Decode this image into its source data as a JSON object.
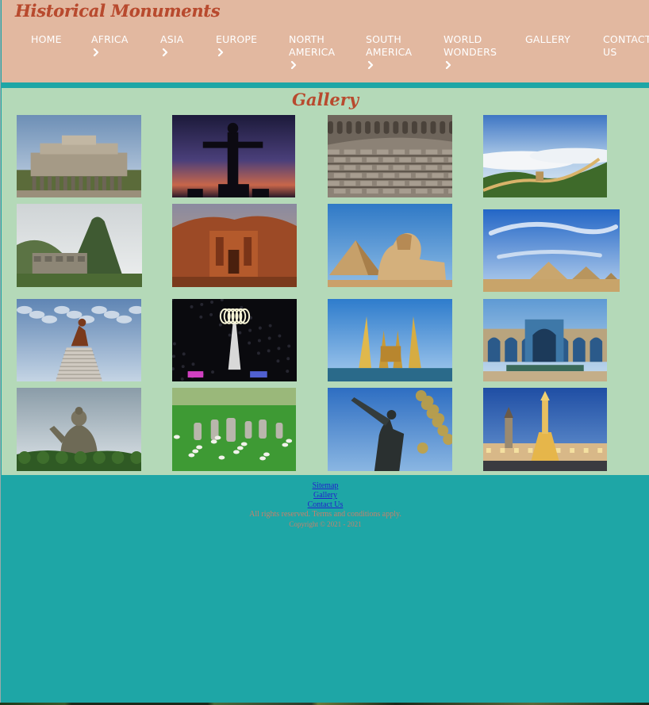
{
  "header": {
    "brand": "Historical Monuments",
    "nav": [
      {
        "label": "HOME",
        "lines": [
          "HOME"
        ],
        "has_chevron": false
      },
      {
        "label": "AFRICA",
        "lines": [
          "AFRICA"
        ],
        "has_chevron": true
      },
      {
        "label": "ASIA",
        "lines": [
          "ASIA"
        ],
        "has_chevron": true
      },
      {
        "label": "EUROPE",
        "lines": [
          "EUROPE"
        ],
        "has_chevron": true
      },
      {
        "label": "NORTH AMERICA",
        "lines": [
          "NORTH",
          "AMERICA"
        ],
        "has_chevron": true
      },
      {
        "label": "SOUTH AMERICA",
        "lines": [
          "SOUTH",
          "AMERICA"
        ],
        "has_chevron": true
      },
      {
        "label": "WORLD WONDERS",
        "lines": [
          "WORLD",
          "WONDERS"
        ],
        "has_chevron": true
      },
      {
        "label": "GALLERY",
        "lines": [
          "GALLERY"
        ],
        "has_chevron": false
      },
      {
        "label": "CONTACT US",
        "lines": [
          "CONTACT",
          "US"
        ],
        "has_chevron": false
      }
    ],
    "icons": {
      "chevron": "chevron-right-icon"
    }
  },
  "gallery": {
    "title": "Gallery",
    "images": [
      {
        "name": "temple-of-warriors-image"
      },
      {
        "name": "christ-the-redeemer-image"
      },
      {
        "name": "colosseum-interior-image"
      },
      {
        "name": "great-wall-image"
      },
      {
        "name": "machu-picchu-image"
      },
      {
        "name": "petra-monastery-image"
      },
      {
        "name": "sphinx-and-pyramid-image"
      },
      {
        "name": "giza-pyramids-image"
      },
      {
        "name": "african-renaissance-monument-image"
      },
      {
        "name": "olympic-cauldron-night-image"
      },
      {
        "name": "democracy-monument-image"
      },
      {
        "name": "nasir-al-mulk-mosque-image"
      },
      {
        "name": "tian-tan-buddha-image"
      },
      {
        "name": "standing-stones-image"
      },
      {
        "name": "bronze-statue-image"
      },
      {
        "name": "holy-trinity-column-image"
      }
    ]
  },
  "footer": {
    "links": [
      "Sitemap",
      "Gallery",
      "Contact Us"
    ],
    "rights": "All rights reserved. Terms and conditions apply.",
    "copyright": "Copyright © 2021 - 2021"
  },
  "colors": {
    "header_bg": "#e2b8a0",
    "brand": "#b84a2e",
    "teal": "#1ea6a6",
    "gallery_bg": "#b4d9b8",
    "link": "#2222cc",
    "footer_text": "#c8806a"
  }
}
